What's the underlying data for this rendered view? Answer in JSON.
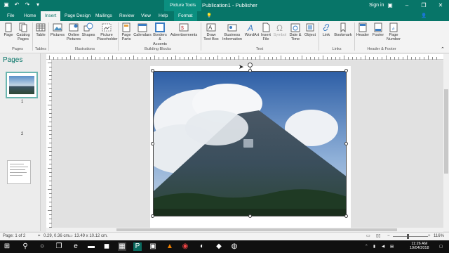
{
  "titlebar": {
    "context_tools": "Picture Tools",
    "doc_title": "Publication1 - Publisher",
    "signin": "Sign in"
  },
  "tabs": [
    {
      "label": "File"
    },
    {
      "label": "Home"
    },
    {
      "label": "Insert"
    },
    {
      "label": "Page Design"
    },
    {
      "label": "Mailings"
    },
    {
      "label": "Review"
    },
    {
      "label": "View"
    },
    {
      "label": "Help"
    },
    {
      "label": "Format"
    }
  ],
  "ribbon": {
    "page": {
      "l1": "Page",
      "l2": ""
    },
    "catalog_pages": {
      "l1": "Catalog",
      "l2": "Pages"
    },
    "table": {
      "l1": "Table",
      "l2": ""
    },
    "pictures": {
      "l1": "Pictures",
      "l2": ""
    },
    "online_pictures": {
      "l1": "Online",
      "l2": "Pictures"
    },
    "shapes": {
      "l1": "Shapes",
      "l2": ""
    },
    "picture_placeholder": {
      "l1": "Picture",
      "l2": "Placeholder"
    },
    "page_parts": {
      "l1": "Page",
      "l2": "Parts"
    },
    "calendars": {
      "l1": "Calendars",
      "l2": ""
    },
    "borders_accents": {
      "l1": "Borders &",
      "l2": "Accents"
    },
    "advertisements": {
      "l1": "Advertisements",
      "l2": ""
    },
    "draw_text_box": {
      "l1": "Draw",
      "l2": "Text Box"
    },
    "business_information": {
      "l1": "Business",
      "l2": "Information"
    },
    "wordart": {
      "l1": "WordArt",
      "l2": ""
    },
    "insert_file": {
      "l1": "Insert",
      "l2": "File"
    },
    "symbol": {
      "l1": "Symbol",
      "l2": ""
    },
    "date_time": {
      "l1": "Date &",
      "l2": "Time"
    },
    "object": {
      "l1": "Object",
      "l2": ""
    },
    "link": {
      "l1": "Link",
      "l2": ""
    },
    "bookmark": {
      "l1": "Bookmark",
      "l2": ""
    },
    "header": {
      "l1": "Header",
      "l2": ""
    },
    "footer": {
      "l1": "Footer",
      "l2": ""
    },
    "page_number": {
      "l1": "Page",
      "l2": "Number"
    },
    "groups": {
      "pages": "Pages",
      "tables": "Tables",
      "illustrations": "Illustrations",
      "building_blocks": "Building Blocks",
      "text": "Text",
      "links": "Links",
      "header_footer": "Header & Footer"
    }
  },
  "pages_pane": {
    "title": "Pages",
    "page1": "1",
    "page2": "2"
  },
  "status": {
    "page": "Page: 1 of 2",
    "position": "0.29, 0.36 cm.",
    "size": "13.49 x 10.12 cm.",
    "zoom": "116%"
  },
  "taskbar": {
    "time": "11:26 AM",
    "date": "19/04/2018"
  },
  "colors": {
    "accent": "#077568",
    "accent_light": "#0b8f80"
  }
}
